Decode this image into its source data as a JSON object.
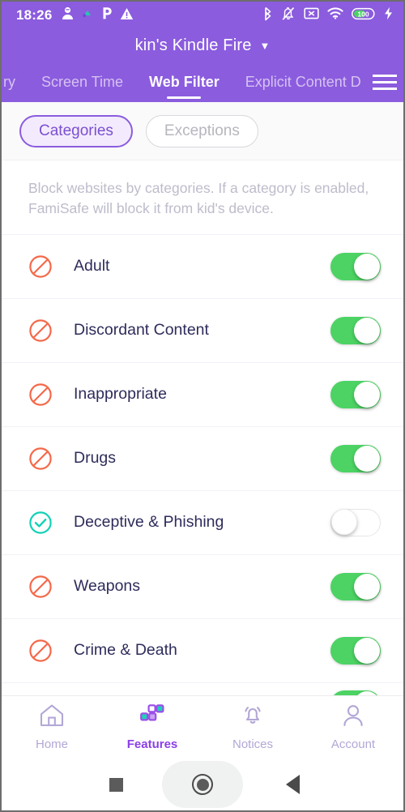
{
  "status_bar": {
    "time": "18:26",
    "left_icons": [
      "person-alert-icon",
      "bug-icon",
      "parking-p-icon",
      "warning-triangle-icon"
    ],
    "right_icons": [
      "bluetooth-icon",
      "notifications-muted-icon",
      "no-sim-icon",
      "wifi-icon",
      "battery-icon",
      "charging-bolt-icon"
    ],
    "battery_level": "100"
  },
  "header": {
    "device_title": "kin's Kindle Fire",
    "caret": "▼",
    "accent_color": "#8B5CDE",
    "menu_icon": "hamburger-menu-icon",
    "tabs": [
      {
        "label": "ry",
        "active": false
      },
      {
        "label": "Screen Time",
        "active": false
      },
      {
        "label": "Web Filter",
        "active": true
      },
      {
        "label": "Explicit Content D",
        "active": false
      }
    ]
  },
  "segments": {
    "categories_label": "Categories",
    "exceptions_label": "Exceptions",
    "selected": "Categories"
  },
  "main": {
    "description": "Block websites by categories. If a category is enabled, FamiSafe will block it from kid's device.",
    "categories": [
      {
        "label": "Adult",
        "icon": "blocked-icon",
        "enabled": true
      },
      {
        "label": "Discordant Content",
        "icon": "blocked-icon",
        "enabled": true
      },
      {
        "label": "Inappropriate",
        "icon": "blocked-icon",
        "enabled": true
      },
      {
        "label": "Drugs",
        "icon": "blocked-icon",
        "enabled": true
      },
      {
        "label": "Deceptive & Phishing",
        "icon": "allowed-check-icon",
        "enabled": false
      },
      {
        "label": "Weapons",
        "icon": "blocked-icon",
        "enabled": true
      },
      {
        "label": "Crime & Death",
        "icon": "blocked-icon",
        "enabled": true
      }
    ],
    "blocked_icon_color": "#F4694A",
    "allowed_icon_color": "#12D1B6",
    "toggle_on_color": "#4CD364"
  },
  "bottom_nav": {
    "items": [
      {
        "label": "Home",
        "icon": "home-icon",
        "active": false
      },
      {
        "label": "Features",
        "icon": "features-grid-icon",
        "active": true
      },
      {
        "label": "Notices",
        "icon": "bell-icon",
        "active": false
      },
      {
        "label": "Account",
        "icon": "person-icon",
        "active": false
      }
    ],
    "active_color": "#8B3FE8",
    "inactive_color": "#B3A7D6"
  },
  "system_nav": {
    "recents": "recents-square-icon",
    "home": "home-circle-icon",
    "back": "back-triangle-icon"
  }
}
